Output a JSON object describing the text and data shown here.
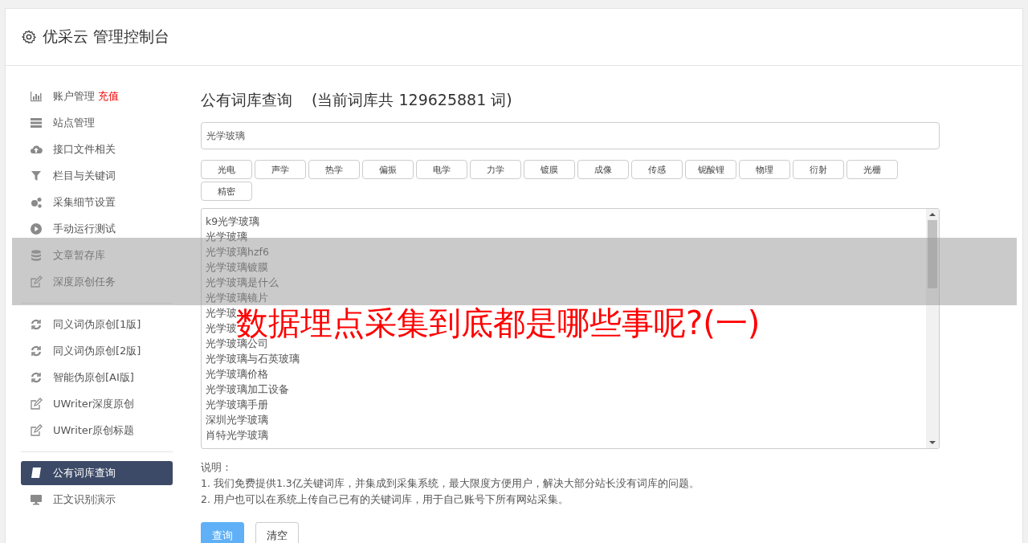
{
  "header": {
    "title": "优采云 管理控制台"
  },
  "sidebar": {
    "groups": [
      [
        {
          "label": "账户管理",
          "badge": "充值",
          "selected": false
        },
        {
          "label": "站点管理",
          "selected": false
        },
        {
          "label": "接口文件相关",
          "selected": false
        },
        {
          "label": "栏目与关键词",
          "selected": false
        },
        {
          "label": "采集细节设置",
          "selected": false
        },
        {
          "label": "手动运行测试",
          "selected": false
        },
        {
          "label": "文章暂存库",
          "selected": false
        },
        {
          "label": "深度原创任务",
          "selected": false
        }
      ],
      [
        {
          "label": "同义词伪原创[1版]",
          "selected": false
        },
        {
          "label": "同义词伪原创[2版]",
          "selected": false
        },
        {
          "label": "智能伪原创[AI版]",
          "selected": false
        },
        {
          "label": "UWriter深度原创",
          "selected": false
        },
        {
          "label": "UWriter原创标题",
          "selected": false
        }
      ],
      [
        {
          "label": "公有词库查询",
          "selected": true
        },
        {
          "label": "正文识别演示",
          "selected": false
        }
      ]
    ]
  },
  "main": {
    "title": "公有词库查询",
    "subtitle": "(当前词库共 129625881 词)",
    "search": {
      "value": "光学玻璃"
    },
    "tags": [
      "光电",
      "声学",
      "热学",
      "偏振",
      "电学",
      "力学",
      "镀膜",
      "成像",
      "传感",
      "铌酸锂",
      "物理",
      "衍射",
      "光栅",
      "精密"
    ],
    "results": [
      "k9光学玻璃",
      "光学玻璃",
      "光学玻璃hzf6",
      "光学玻璃镀膜",
      "光学玻璃是什么",
      "光学玻璃镜片",
      "光学玻",
      "光学玻",
      "光学玻璃公司",
      "光学玻璃与石英玻璃",
      "光学玻璃价格",
      "光学玻璃加工设备",
      "光学玻璃手册",
      "深圳光学玻璃",
      "肖特光学玻璃"
    ],
    "notes": {
      "heading": "说明：",
      "lines": [
        "1. 我们免费提供1.3亿关键词库，并集成到采集系统，最大限度方便用户，解决大部分站长没有词库的问题。",
        "2. 用户也可以在系统上传自己已有的关键词库，用于自己账号下所有网站采集。"
      ]
    },
    "buttons": [
      {
        "label": "查询",
        "kind": "primary"
      },
      {
        "label": "清空",
        "kind": "default"
      }
    ]
  },
  "overlay": {
    "title": "数据埋点采集到底都是哪些事呢?(一)"
  }
}
